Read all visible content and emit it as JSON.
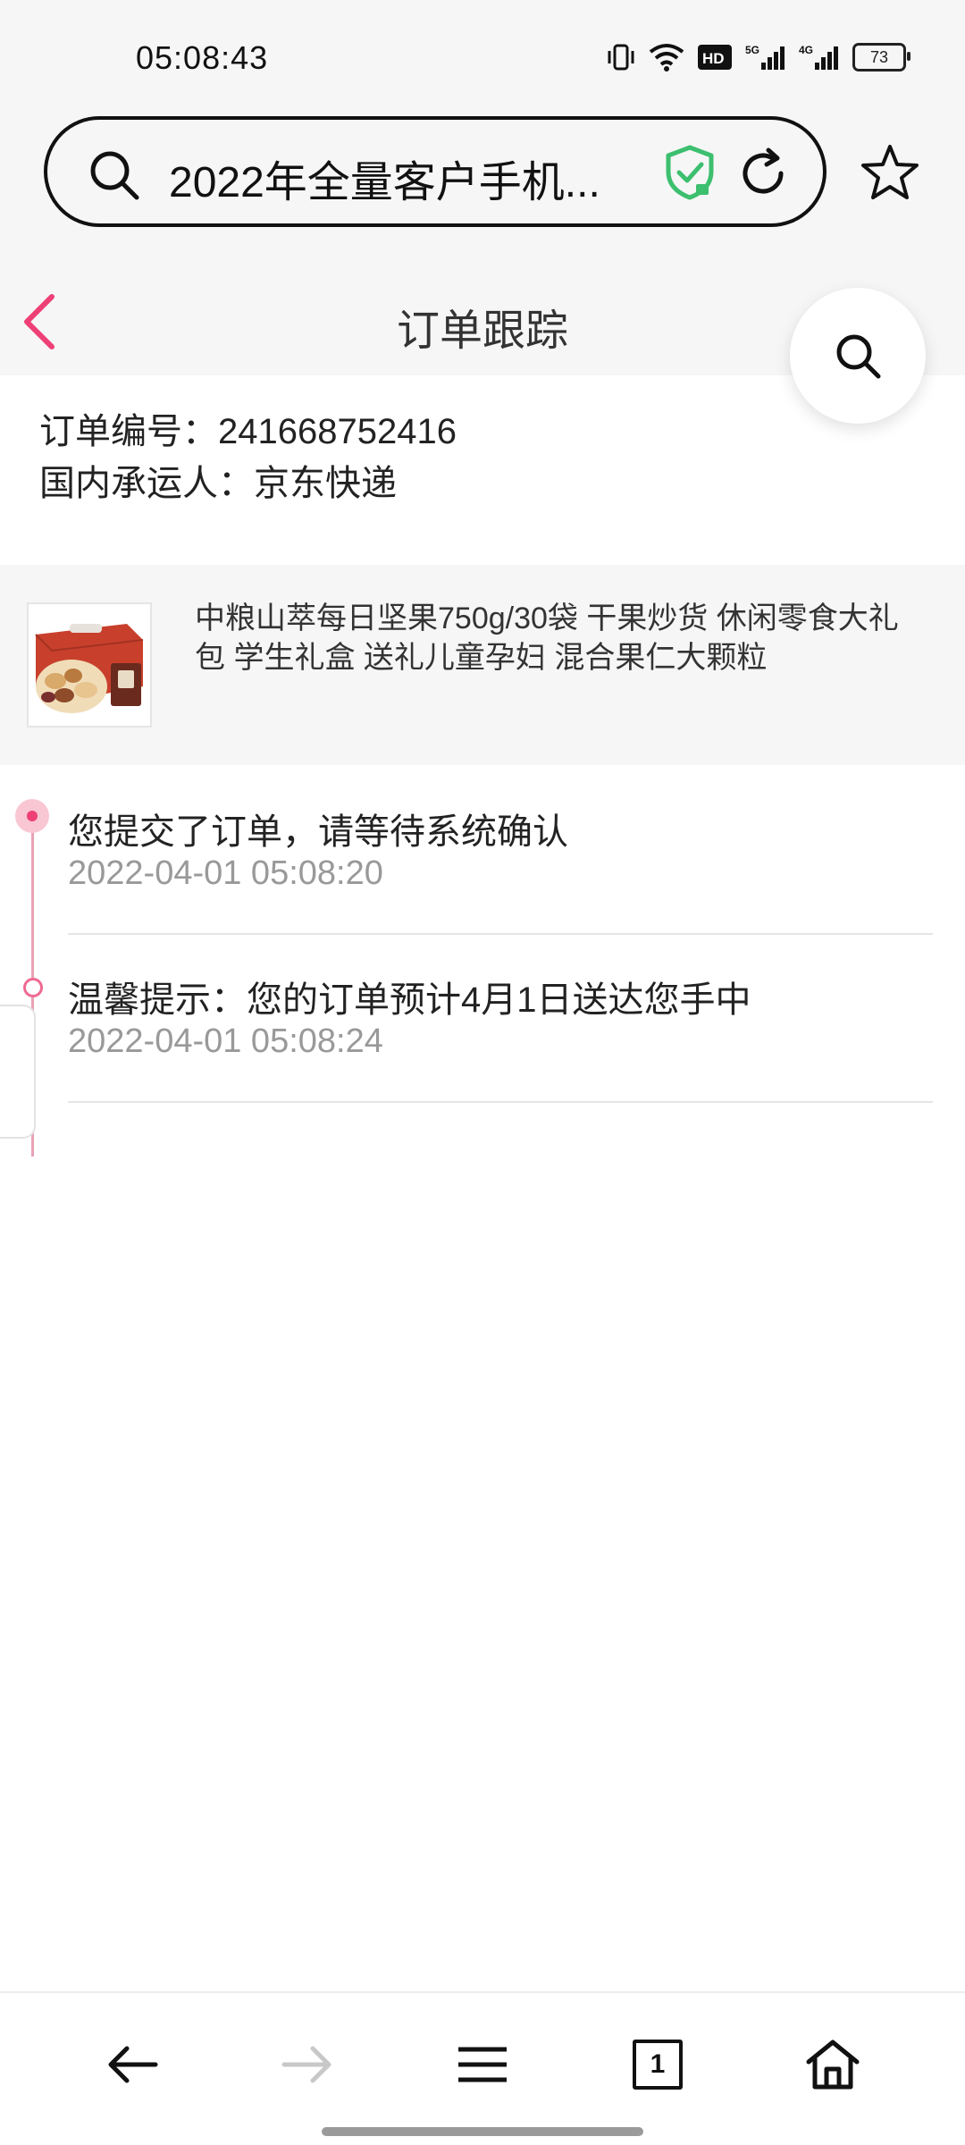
{
  "status_bar": {
    "time": "05:08:43",
    "battery": "73"
  },
  "browser": {
    "address_text": "2022年全量客户手机...",
    "tab_count": "1"
  },
  "page": {
    "title": "订单跟踪"
  },
  "order": {
    "number_line": "订单编号：241668752416",
    "carrier_line": "国内承运人：京东快递"
  },
  "product": {
    "name": "中粮山萃每日坚果750g/30袋 干果炒货 休闲零食大礼包 学生礼盒 送礼儿童孕妇 混合果仁大颗粒"
  },
  "timeline": [
    {
      "text": "您提交了订单，请等待系统确认",
      "time": "2022-04-01 05:08:20"
    },
    {
      "text": "温馨提示：您的订单预计4月1日送达您手中",
      "time": "2022-04-01 05:08:24"
    }
  ],
  "colors": {
    "accent": "#ee3f76",
    "timeline_line": "#e9a2b6",
    "shield_green": "#3cbf6e"
  },
  "icons": {
    "back": "back-arrow-icon",
    "search": "search-icon",
    "shield": "security-shield-icon",
    "reload": "reload-icon",
    "favorite": "star-icon",
    "nav_back": "arrow-left-icon",
    "nav_forward": "arrow-right-icon",
    "menu": "menu-icon",
    "home": "home-icon"
  }
}
